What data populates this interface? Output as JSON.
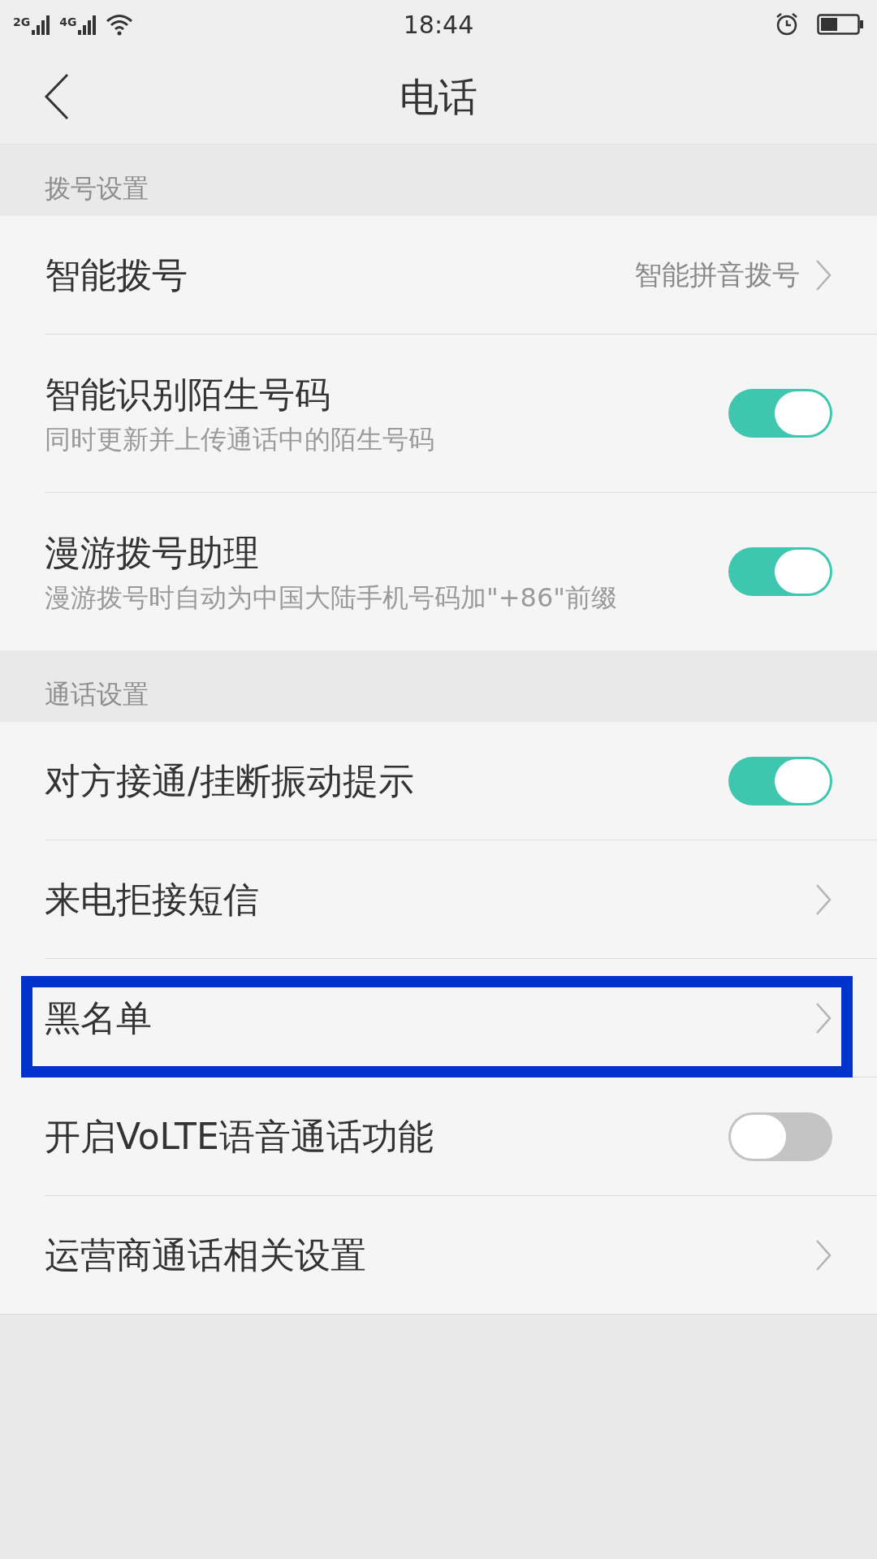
{
  "status_bar": {
    "signal_1": "2G",
    "signal_2": "4G",
    "time": "18:44"
  },
  "header": {
    "title": "电话"
  },
  "sections": [
    {
      "title": "拨号设置",
      "items": [
        {
          "kind": "link",
          "label": "智能拨号",
          "value": "智能拼音拨号",
          "highlighted": false
        },
        {
          "kind": "toggle",
          "label": "智能识别陌生号码",
          "subtitle": "同时更新并上传通话中的陌生号码",
          "on": true,
          "highlighted": false
        },
        {
          "kind": "toggle",
          "label": "漫游拨号助理",
          "subtitle": "漫游拨号时自动为中国大陆手机号码加\"+86\"前缀",
          "on": true,
          "highlighted": false
        }
      ]
    },
    {
      "title": "通话设置",
      "items": [
        {
          "kind": "toggle",
          "label": "对方接通/挂断振动提示",
          "on": true,
          "highlighted": false
        },
        {
          "kind": "link",
          "label": "来电拒接短信",
          "highlighted": false
        },
        {
          "kind": "link",
          "label": "黑名单",
          "highlighted": true
        },
        {
          "kind": "toggle",
          "label": "开启VoLTE语音通话功能",
          "on": false,
          "highlighted": false
        },
        {
          "kind": "link",
          "label": "运营商通话相关设置",
          "highlighted": false
        }
      ]
    }
  ]
}
